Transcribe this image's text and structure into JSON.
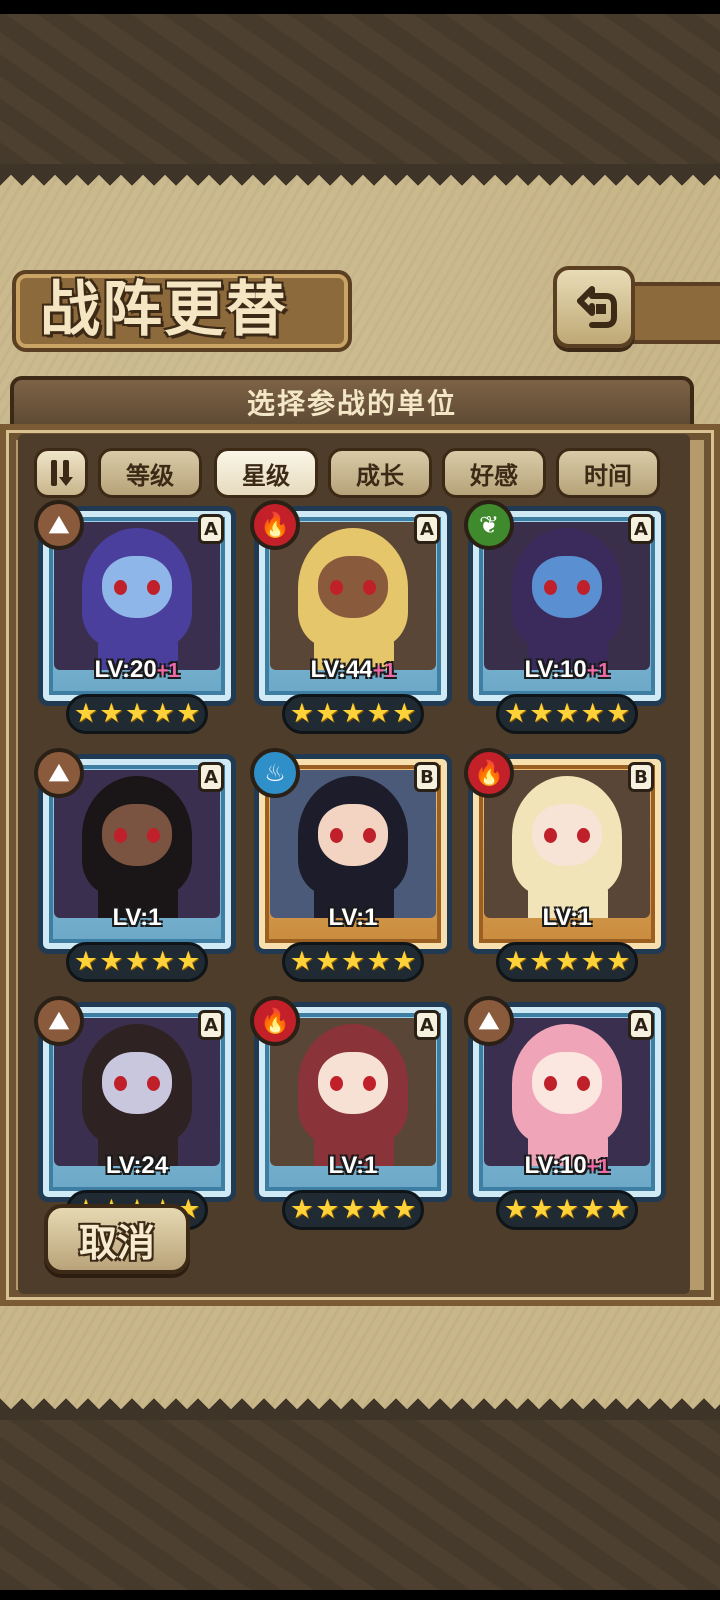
{
  "screen": {
    "title": "战阵更替",
    "subtitle": "选择参战的单位"
  },
  "sort": {
    "tabs": [
      "等级",
      "星级",
      "成长",
      "好感",
      "时间"
    ],
    "active_tab": "星级"
  },
  "cancel_label": "取消",
  "units": [
    {
      "element": "earth",
      "rank": "A",
      "level_text": "LV:20",
      "bonus": "+1",
      "stars": 5,
      "hair": "#4a3f9c",
      "skin": "#8fb6e8"
    },
    {
      "element": "fire",
      "rank": "A",
      "level_text": "LV:44",
      "bonus": "+1",
      "stars": 5,
      "hair": "#e6c66a",
      "skin": "#8a5a3c"
    },
    {
      "element": "nature",
      "rank": "A",
      "level_text": "LV:10",
      "bonus": "+1",
      "stars": 5,
      "hair": "#3b2a5c",
      "skin": "#5a8fd2"
    },
    {
      "element": "earth",
      "rank": "A",
      "level_text": "LV:1",
      "bonus": "",
      "stars": 5,
      "hair": "#1a1516",
      "skin": "#7a5440"
    },
    {
      "element": "water",
      "rank": "B",
      "level_text": "LV:1",
      "bonus": "",
      "stars": 5,
      "hair": "#1c1c2a",
      "skin": "#f3d4c2"
    },
    {
      "element": "fire",
      "rank": "B",
      "level_text": "LV:1",
      "bonus": "",
      "stars": 5,
      "hair": "#f1e4b8",
      "skin": "#f7e4d6"
    },
    {
      "element": "earth",
      "rank": "A",
      "level_text": "LV:24",
      "bonus": "",
      "stars": 5,
      "hair": "#2e2222",
      "skin": "#c9c7de"
    },
    {
      "element": "fire",
      "rank": "A",
      "level_text": "LV:1",
      "bonus": "",
      "stars": 5,
      "hair": "#8a3338",
      "skin": "#f7e0d4"
    },
    {
      "element": "earth",
      "rank": "A",
      "level_text": "LV:10",
      "bonus": "+1",
      "stars": 5,
      "hair": "#f0a4b8",
      "skin": "#fbe6e0"
    }
  ],
  "colors": {
    "parchment": "#c9b78a",
    "frame_blue": "#9fd2ea",
    "frame_gold": "#f0c27a",
    "star": "#ffd23a",
    "bonus": "#f06aa8"
  }
}
